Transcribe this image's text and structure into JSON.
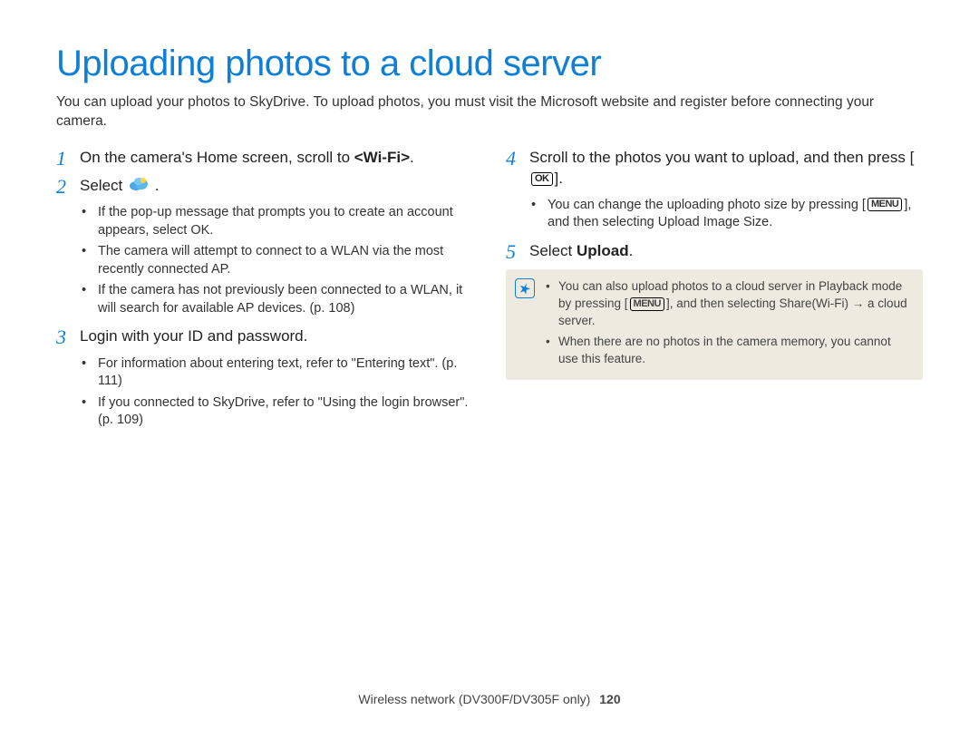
{
  "title": "Uploading photos to a cloud server",
  "intro": "You can upload your photos to SkyDrive. To upload photos, you must visit the Microsoft website and register before connecting your camera.",
  "left": {
    "step1": {
      "num": "1",
      "text_a": "On the camera's Home screen, scroll to ",
      "wifi": "<Wi-Fi>",
      "text_b": "."
    },
    "step2": {
      "num": "2",
      "text_a": "Select ",
      "text_b": "."
    },
    "step2_subs": [
      {
        "a": "If the pop-up message that prompts you to create an account appears, select ",
        "bold": "OK",
        "b": "."
      },
      {
        "a": "The camera will attempt to connect to a WLAN via the most recently connected AP."
      },
      {
        "a": "If the camera has not previously been connected to a WLAN, it will search for available AP devices. (p. 108)"
      }
    ],
    "step3": {
      "num": "3",
      "text": "Login with your ID and password."
    },
    "step3_subs": [
      {
        "a": "For information about entering text, refer to \"Entering text\". (p. 111)"
      },
      {
        "a": "If you connected to SkyDrive, refer to \"Using the login browser\". (p. 109)"
      }
    ]
  },
  "right": {
    "step4": {
      "num": "4",
      "text_a": "Scroll to the photos you want to upload, and then press [",
      "text_b": "]."
    },
    "step4_subs": [
      {
        "a": "You can change the uploading photo size by pressing [",
        "b": "], and then selecting ",
        "bold": "Upload Image Size",
        "c": "."
      }
    ],
    "step5": {
      "num": "5",
      "text_a": "Select ",
      "bold": "Upload",
      "text_b": "."
    },
    "notes": [
      {
        "a": "You can also upload photos to a cloud server in Playback mode by pressing [",
        "b": "], and then selecting ",
        "bold": "Share(Wi-Fi)",
        "c": " ",
        "arrow": "→",
        "d": " a cloud server."
      },
      {
        "a": "When there are no photos in the camera memory, you cannot use this feature."
      }
    ]
  },
  "footer": {
    "section": "Wireless network (DV300F/DV305F only)",
    "page": "120"
  },
  "icons": {
    "ok": "OK",
    "menu": "MENU"
  }
}
